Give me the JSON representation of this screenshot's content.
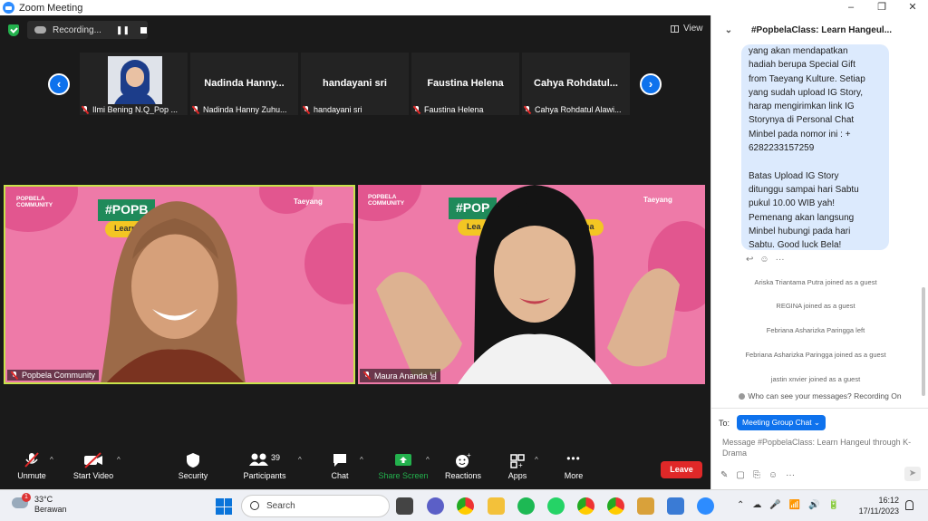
{
  "window": {
    "title": "Zoom Meeting",
    "controls": [
      "–",
      "❐",
      "✕"
    ]
  },
  "recording": {
    "label": "Recording...",
    "pause_glyph": "❚❚"
  },
  "view": {
    "label": "View"
  },
  "nav": {
    "prev_glyph": "‹",
    "next_glyph": "›"
  },
  "participants_strip": [
    {
      "display_name": "",
      "label": "Ilmi Bening N.Q_Pop ...",
      "has_video": true
    },
    {
      "display_name": "Nadinda Hanny...",
      "label": "Nadinda Hanny Zuhu...",
      "has_video": false
    },
    {
      "display_name": "handayani sri",
      "label": "handayani sri",
      "has_video": false
    },
    {
      "display_name": "Faustina Helena",
      "label": "Faustina Helena",
      "has_video": false
    },
    {
      "display_name": "Cahya Rohdatul...",
      "label": "Cahya Rohdatul Alawi...",
      "has_video": false
    }
  ],
  "video_tiles": [
    {
      "label": "Popbela Community",
      "brand_left": "POPBELA\nCOMMUNITY",
      "brand_right": "Taeyang",
      "banner": "#POPB",
      "sub": "Learn"
    },
    {
      "label": "Maura Ananda 님",
      "brand_left": "POPBELA\nCOMMUNITY",
      "brand_right": "Taeyang",
      "banner": "#POP",
      "sub": "Lea",
      "sub_right": "na"
    }
  ],
  "toolbar": {
    "unmute": "Unmute",
    "start_video": "Start Video",
    "security": "Security",
    "participants": "Participants",
    "participants_count": "39",
    "chat": "Chat",
    "share_screen": "Share Screen",
    "reactions": "Reactions",
    "apps": "Apps",
    "more": "More",
    "leave": "Leave",
    "caret": "^",
    "more_glyph": "•••"
  },
  "chat": {
    "title": "#PopbelaClass: Learn Hangeul...",
    "header_chevron": "⌄",
    "message": "yang akan mendapatkan\nhadiah berupa Special Gift\nfrom Taeyang Kulture. Setiap\nyang sudah upload IG Story,\nharap mengirimkan link IG\nStorynya di Personal Chat\nMinbel pada nomor ini : +\n6282233157259\n\nBatas Upload IG Story\nditunggu sampai hari Sabtu\npukul 10.00 WIB yah!\nPemenang akan langsung\nMinbel hubungi pada hari\nSabtu. Good luck Bela!",
    "message_actions": [
      "↩",
      "☺",
      "···"
    ],
    "system_messages": [
      "Ariska Triantama Putra joined as a guest",
      "REGINA joined as a guest",
      "Febriana Asharizka Paringga left",
      "Febriana Asharizka Paringga joined as a guest",
      "jastin xnvier joined as a guest"
    ],
    "privacy_note": "Who can see your messages? Recording On",
    "to_label": "To:",
    "recipient": "Meeting Group Chat ⌄",
    "input_placeholder": "Message #PopbelaClass: Learn Hangeul through K-Drama",
    "tools": [
      "✎",
      "▢",
      "⎘",
      "☺",
      "···"
    ],
    "send_glyph": "➤"
  },
  "taskbar": {
    "weather_temp": "33°C",
    "weather_desc": "Berawan",
    "weather_badge": "1",
    "search_placeholder": "Search",
    "systray_glyphs": [
      "⌃",
      "☁",
      "🎤",
      "📶",
      "🔊",
      "🔋"
    ],
    "time": "16:12",
    "date": "17/11/2023"
  },
  "colors": {
    "accent": "#0e72ed",
    "leave": "#e02828",
    "share": "#23b14d",
    "bubble": "#dceafd",
    "tile_bg": "#ee7aa8"
  }
}
